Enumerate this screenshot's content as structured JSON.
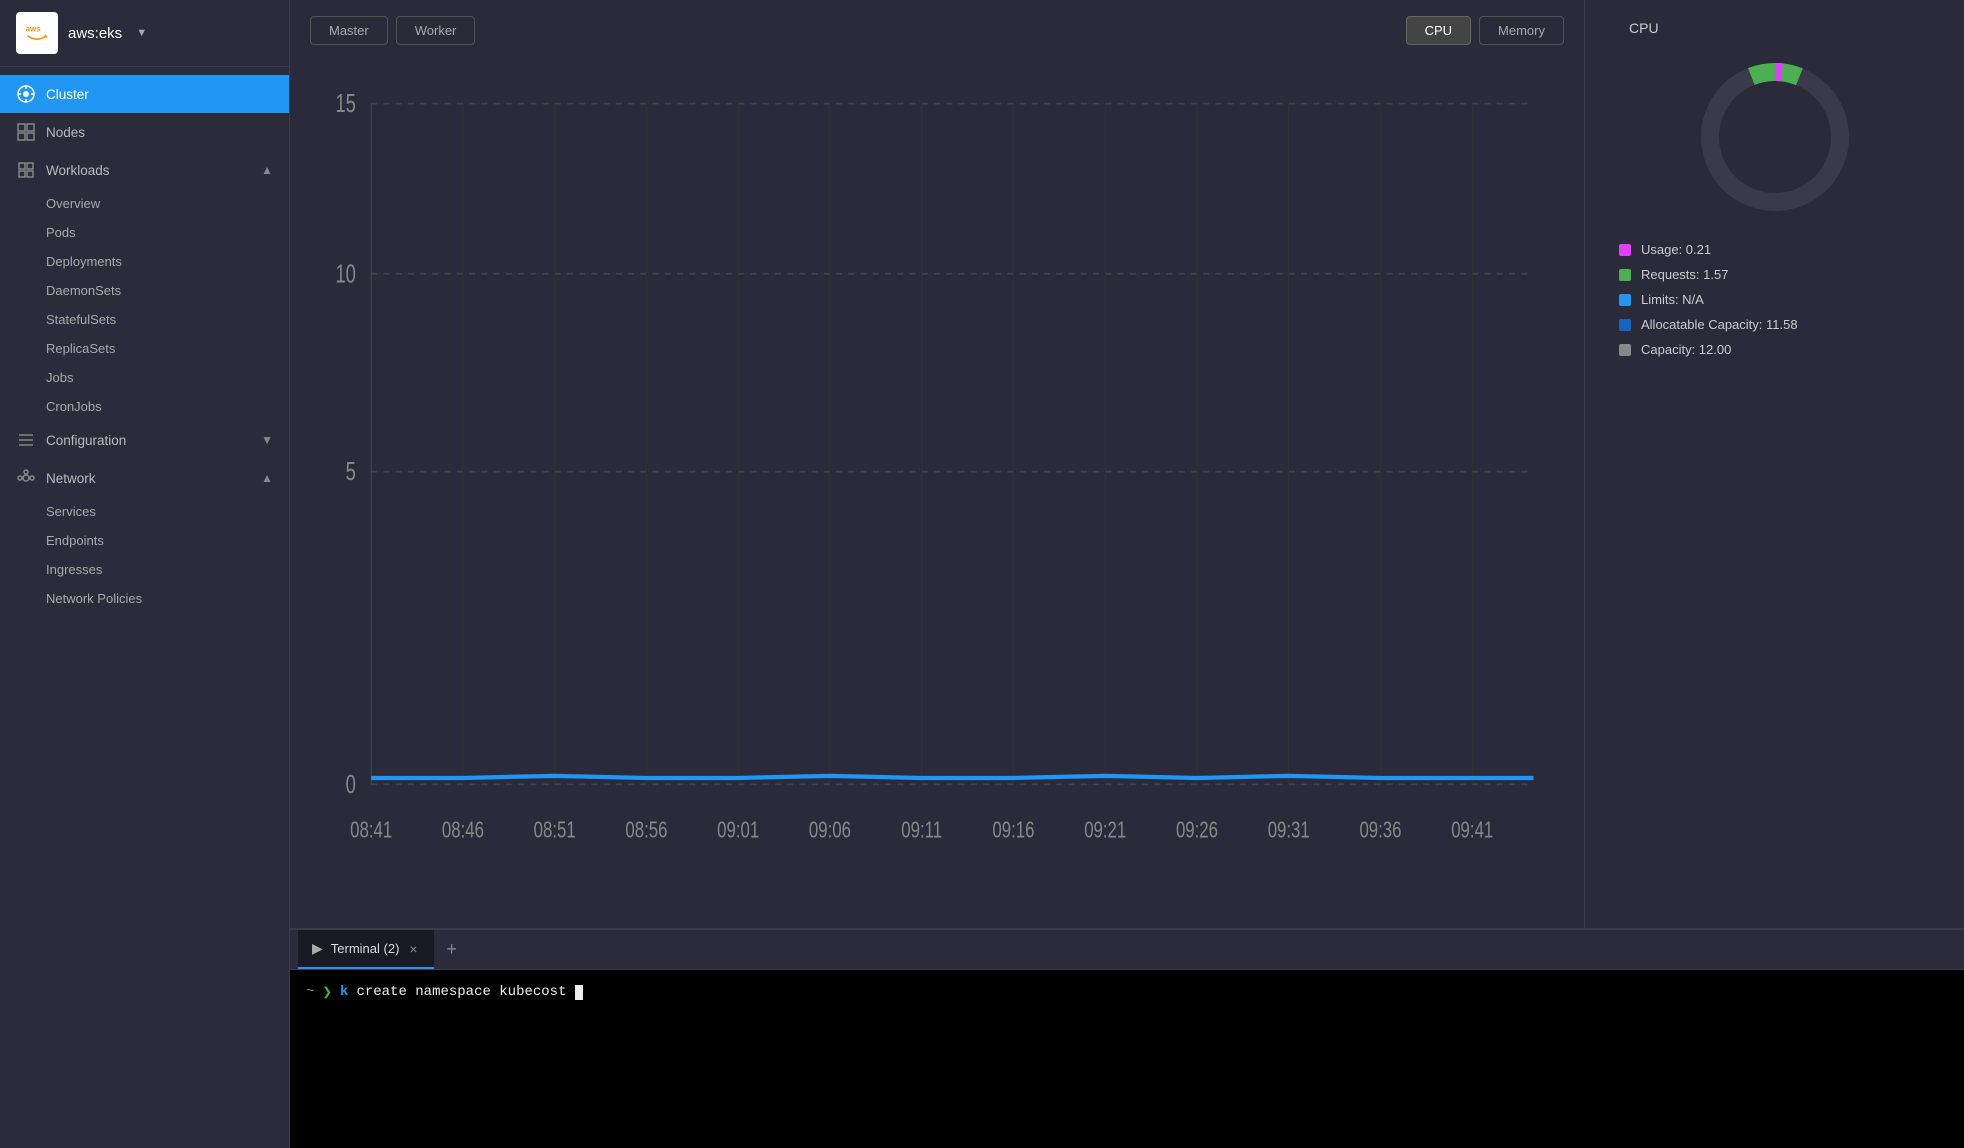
{
  "app": {
    "title": "aws:eks",
    "logo": "aws"
  },
  "sidebar": {
    "main_items": [
      {
        "id": "cluster",
        "label": "Cluster",
        "icon": "⚙",
        "active": true
      },
      {
        "id": "nodes",
        "label": "Nodes",
        "icon": "▦"
      },
      {
        "id": "workloads",
        "label": "Workloads",
        "icon": "◫",
        "expand": "▲"
      },
      {
        "id": "configuration",
        "label": "Configuration",
        "icon": "≡",
        "expand": "▼"
      },
      {
        "id": "network",
        "label": "Network",
        "icon": "✦",
        "expand": "▲"
      }
    ],
    "workloads_sub": [
      "Overview",
      "Pods",
      "Deployments",
      "DaemonSets",
      "StatefulSets",
      "ReplicaSets",
      "Jobs",
      "CronJobs"
    ],
    "network_sub": [
      "Services",
      "Endpoints",
      "Ingresses",
      "Network Policies"
    ]
  },
  "chart": {
    "master_label": "Master",
    "worker_label": "Worker",
    "cpu_label": "CPU",
    "memory_label": "Memory",
    "y_labels": [
      "15",
      "10",
      "5",
      "0"
    ],
    "x_labels": [
      "08:41",
      "08:46",
      "08:51",
      "08:56",
      "09:01",
      "09:06",
      "09:11",
      "09:16",
      "09:21",
      "09:26",
      "09:31",
      "09:36",
      "09:41"
    ]
  },
  "right_panel": {
    "title": "CPU",
    "legend": [
      {
        "color": "#e040fb",
        "label": "Usage: 0.21"
      },
      {
        "color": "#4caf50",
        "label": "Requests: 1.57"
      },
      {
        "color": "#2196f3",
        "label": "Limits: N/A"
      },
      {
        "color": "#1565c0",
        "label": "Allocatable Capacity: 11.58"
      },
      {
        "color": "#888",
        "label": "Capacity: 12.00"
      }
    ]
  },
  "terminal": {
    "tab_label": "Terminal (2)",
    "close_icon": "×",
    "add_icon": "+",
    "prompt_tilde": "~",
    "prompt_arrow": "❯",
    "prompt_k": "k",
    "command": "create namespace kubecost"
  }
}
